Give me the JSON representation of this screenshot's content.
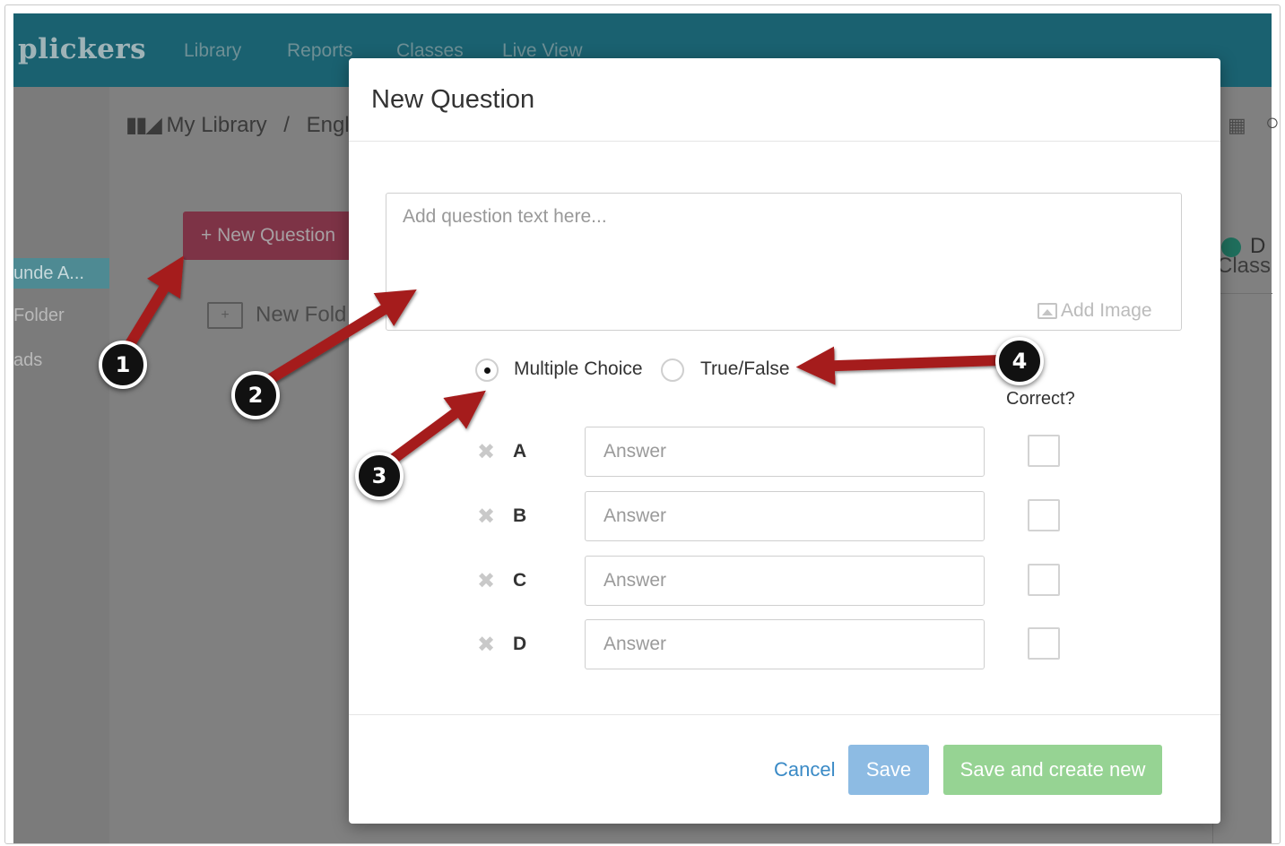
{
  "app": {
    "logo": "plickers",
    "nav": [
      "Library",
      "Reports",
      "Classes",
      "Live View"
    ],
    "sidebar": [
      "unde A...",
      "Folder",
      "ads"
    ],
    "breadcrumb_root": "My Library",
    "breadcrumb_sep": "/",
    "breadcrumb_current": "Engli",
    "new_question_button": "+ New Question",
    "new_folder_label": "New Fold",
    "right_panel_label": "Class",
    "right_panel_item": "D"
  },
  "modal": {
    "title": "New Question",
    "question_placeholder": "Add question text here...",
    "add_image_label": "Add Image",
    "type_options": {
      "multiple_choice": "Multiple Choice",
      "true_false": "True/False",
      "selected": "Multiple Choice"
    },
    "correct_header": "Correct?",
    "answers": [
      {
        "letter": "A",
        "placeholder": "Answer",
        "correct": false
      },
      {
        "letter": "B",
        "placeholder": "Answer",
        "correct": false
      },
      {
        "letter": "C",
        "placeholder": "Answer",
        "correct": false
      },
      {
        "letter": "D",
        "placeholder": "Answer",
        "correct": false
      }
    ],
    "buttons": {
      "cancel": "Cancel",
      "save": "Save",
      "save_and_create_new": "Save and create new"
    }
  },
  "annotations": {
    "callouts": [
      "1",
      "2",
      "3",
      "4"
    ],
    "arrow_color": "#a51e1e"
  },
  "colors": {
    "topbar": "#1a6170",
    "save_button": "#8dbbe3",
    "save_new_button": "#96d393",
    "cancel_link": "#3a8ac6"
  }
}
